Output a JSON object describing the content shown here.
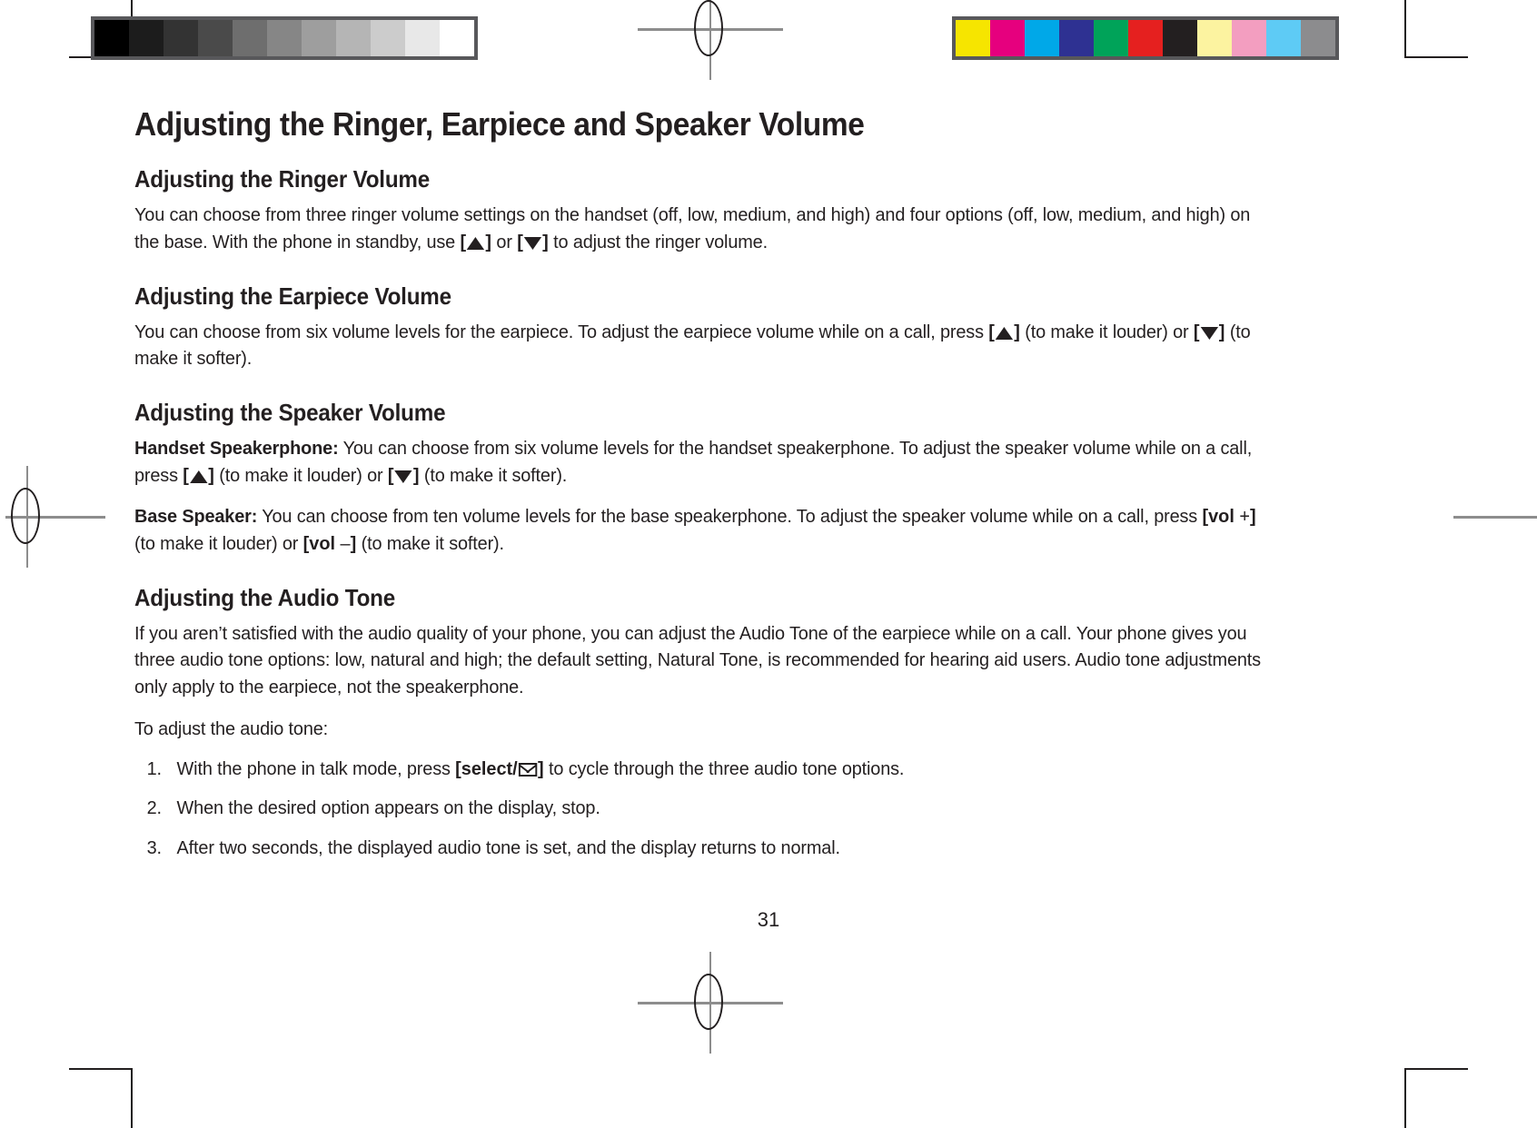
{
  "page": {
    "number": "31"
  },
  "calibration": {
    "gray_wedge": [
      "#000000",
      "#1c1c1c",
      "#333333",
      "#4a4a4a",
      "#6e6e6e",
      "#868686",
      "#9e9e9e",
      "#b5b5b5",
      "#cccccc",
      "#e8e8e8",
      "#ffffff"
    ],
    "color_bar": [
      "#f6e500",
      "#e6007e",
      "#00a8e8",
      "#2e3192",
      "#00a359",
      "#e5201f",
      "#231f20",
      "#fcf3a0",
      "#f39ec0",
      "#5ecbf5",
      "#8c8c8e"
    ],
    "frame_color": "#58585b"
  },
  "document": {
    "title": "Adjusting the Ringer, Earpiece and Speaker Volume",
    "sections": [
      {
        "heading": "Adjusting the Ringer Volume",
        "paragraph_part1": "You can choose from three ringer volume settings on the handset (off, low, medium, and high) and four options (off, low, medium, and high) on the base. With the phone in standby, use ",
        "key_up": "[▲]",
        "between": " or ",
        "key_down": "[▼]",
        "paragraph_part2": " to adjust the ringer volume."
      },
      {
        "heading": "Adjusting the Earpiece Volume",
        "paragraph_part1": "You can choose from six volume levels for the earpiece. To adjust the earpiece volume while on a call, press ",
        "key_up": "[▲]",
        "between": " (to make it louder) or ",
        "key_down": "[▼]",
        "paragraph_part2": " (to make it softer)."
      },
      {
        "heading": "Adjusting the Speaker Volume",
        "handset": {
          "lead_in": "Handset Speakerphone:",
          "part1": " You can choose from six volume levels for the handset speakerphone. To adjust the speaker volume while on a call, press ",
          "key_up": "[▲]",
          "between": " (to make it louder) or ",
          "key_down": "[▼]",
          "part2": " (to make it softer)."
        },
        "base": {
          "lead_in": "Base Speaker:",
          "part1": " You can choose from ten volume levels for the base speakerphone. To adjust the speaker volume while on a call, press ",
          "key_vol_plus_label": "vol",
          "key_vol_plus_sign": "+",
          "between": " (to make it louder) or ",
          "key_vol_minus_label": "vol",
          "key_vol_minus_sign": "–",
          "part2": " (to make it softer)."
        }
      },
      {
        "heading": "Adjusting the Audio Tone",
        "paragraph": "If you aren’t satisfied with the audio quality of your phone, you can adjust the Audio Tone of the earpiece while on a call. Your phone gives you three audio tone options: low, natural and high; the default setting, Natural Tone, is recommended for hearing aid users. Audio tone adjustments only apply to the earpiece, not the speakerphone.",
        "intro": "To adjust the audio tone:",
        "steps": [
          {
            "num": "1.",
            "part1": "With the phone in talk mode, press ",
            "key_label": "select/",
            "part2": "  to cycle through the three audio tone options."
          },
          {
            "num": "2.",
            "part1": "When the desired option appears on the display, stop.",
            "key_label": "",
            "part2": ""
          },
          {
            "num": "3.",
            "part1": "After two seconds, the displayed audio tone is set, and the display returns to normal.",
            "key_label": "",
            "part2": ""
          }
        ]
      }
    ]
  }
}
